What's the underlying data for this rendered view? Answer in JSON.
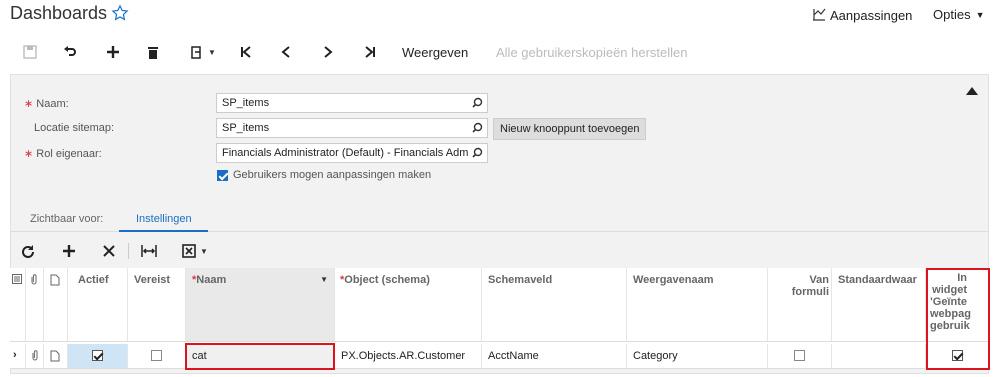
{
  "header": {
    "title": "Dashboards",
    "customizations": "Aanpassingen",
    "options": "Opties"
  },
  "toolbar": {
    "view": "Weergeven",
    "reset_all": "Alle gebruikerskopieën herstellen"
  },
  "form": {
    "name_label": "Naam:",
    "name_value": "SP_items",
    "sitemap_label": "Locatie sitemap:",
    "sitemap_value": "SP_items",
    "new_node_button": "Nieuw knooppunt toevoegen",
    "owner_label": "Rol eigenaar:",
    "owner_value": "Financials Administrator (Default) - Financials Adm",
    "allow_custom_label": "Gebruikers mogen aanpassingen maken",
    "allow_custom_checked": true
  },
  "tabs": [
    {
      "label": "Zichtbaar voor:",
      "active": false
    },
    {
      "label": "Instellingen",
      "active": true
    }
  ],
  "grid": {
    "columns": {
      "active": "Actief",
      "required": "Vereist",
      "name": "Naam",
      "object": "Object (schema)",
      "field": "Schemaveld",
      "display": "Weergavenaam",
      "from_form_1": "Van",
      "from_form_2": "formuli",
      "default": "Standaardwaar",
      "widget_1": "In",
      "widget_2": "widget",
      "widget_3": "'Geïnte",
      "widget_4": "webpag",
      "widget_5": "gebruik"
    },
    "rows": [
      {
        "active": true,
        "required": false,
        "name": "cat",
        "object": "PX.Objects.AR.Customer",
        "field": "AcctName",
        "display": "Category",
        "from_form": false,
        "default": "",
        "in_widget": true
      }
    ]
  },
  "colors": {
    "accent": "#1a6fc4",
    "highlight_border": "#d9161c",
    "required": "#d9363e"
  }
}
